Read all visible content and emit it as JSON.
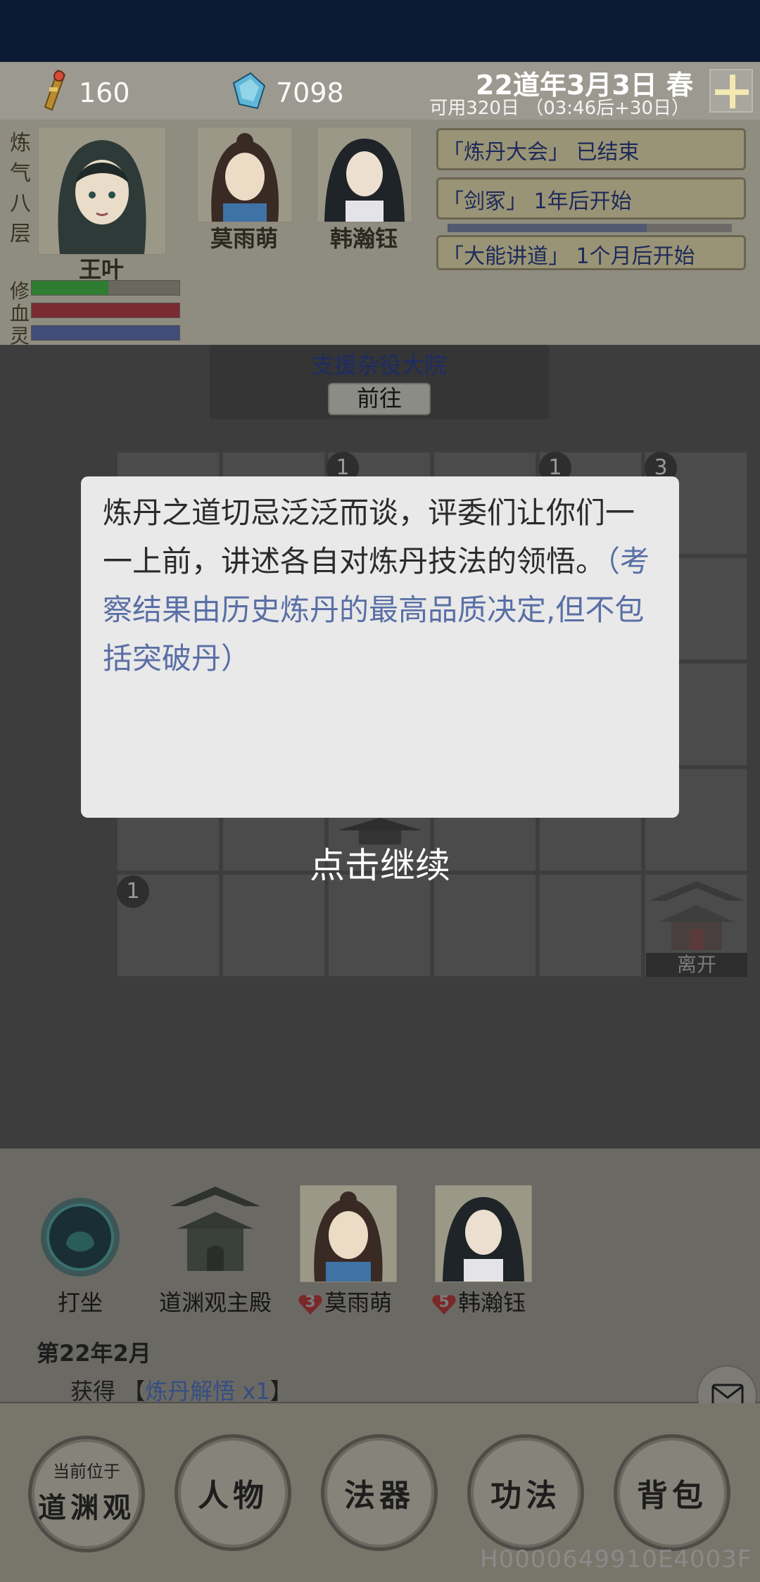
{
  "resources": {
    "scroll_amount": "160",
    "spirit_stone": "7098",
    "scroll_icon": "scroll-token-icon",
    "stone_icon": "spirit-stone-icon"
  },
  "date": {
    "main": "22道年3月3日 春",
    "sub": "可用320日 （03:46后+30日）"
  },
  "player": {
    "realm_chars": [
      "炼",
      "气",
      "八",
      "层"
    ],
    "name": "王叶",
    "bars": [
      {
        "label": "修",
        "fill": 0.52,
        "color": "#2e7d32"
      },
      {
        "label": "血",
        "fill": 1.0,
        "color": "#7a2a32"
      },
      {
        "label": "灵",
        "fill": 1.0,
        "color": "#414c78"
      }
    ]
  },
  "companions": [
    {
      "name": "莫雨萌"
    },
    {
      "name": "韩瀚钰"
    }
  ],
  "events": [
    {
      "text": "「炼丹大会」 已结束"
    },
    {
      "text": "「剑冢」 1年后开始"
    },
    {
      "text": "「大能讲道」 1个月后开始"
    }
  ],
  "event_progress": 0.7,
  "support": {
    "title": "支援杂役大院",
    "button": "前往"
  },
  "map": {
    "badges": [
      {
        "label": "1"
      },
      {
        "label": "1"
      },
      {
        "label": "3"
      },
      {
        "label": "1"
      }
    ],
    "leave_label": "离开"
  },
  "dialog": {
    "text": "炼丹之道切忌泛泛而谈，评委们让你们一一上前，讲述各自对炼丹技法的领悟。",
    "hint": "（考察结果由历史炼丹的最高品质决定,但不包括突破丹）",
    "continue": "点击继续"
  },
  "locations": [
    {
      "name": "打坐",
      "icon": "meditation-orb-icon"
    },
    {
      "name": "道渊观主殿",
      "icon": "temple-hall-icon"
    },
    {
      "name": "莫雨萌",
      "icon": "companion-portrait",
      "hearts": "3"
    },
    {
      "name": "韩瀚钰",
      "icon": "companion-portrait",
      "hearts": "5"
    }
  ],
  "log": {
    "date": "第22年2月",
    "prefix": "获得 【",
    "item": "炼丹解悟 x1",
    "suffix": "】"
  },
  "nav": {
    "loc_top": "当前位于",
    "loc_main": "道渊观",
    "character": "人物",
    "artifact": "法器",
    "skills": "功法",
    "bag": "背包"
  },
  "build_id": "H0000649910E4003F"
}
